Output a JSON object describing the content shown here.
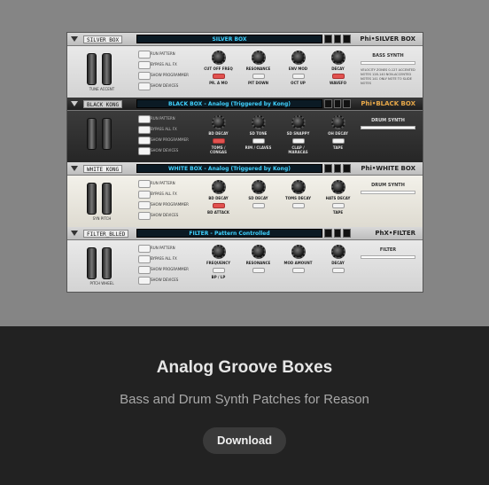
{
  "product": {
    "title": "Analog Groove Boxes",
    "subtitle": "Bass and Drum Synth Patches for Reason",
    "download_label": "Download"
  },
  "rack": {
    "units": [
      {
        "patch": "SILVER BOX",
        "display": "SILVER BOX",
        "brand": "Phi•SILVER BOX",
        "style": "light",
        "wheel_labels": "TUNE     ACCENT",
        "buttons": [
          "RUN PATTERN",
          "BYPASS ALL FX",
          "SHOW PROGRAMMER",
          "SHOW DEVICES"
        ],
        "knobs": [
          {
            "label": "CUT OFF FREQ",
            "led": "PR. A MO",
            "on": true
          },
          {
            "label": "RESONANCE",
            "led": "PIT DOWN",
            "on": false
          },
          {
            "label": "ENV MOD",
            "led": "OCT UP",
            "on": false
          },
          {
            "label": "DECAY",
            "led": "WAVEFO",
            "on": true
          }
        ],
        "panel_label": "BASS SYNTH",
        "panel_note": "VELOCITY ZONES\n0-127 ACCENTED NOTES\n128-140 NON-ACCENTED NOTES\n141 ONLY NOTE TO SLIDE NOTES"
      },
      {
        "patch": "BLACK KONG",
        "display": "BLACK BOX - Analog (Triggered by Kong)",
        "brand": "Phi•BLACK BOX",
        "style": "dark",
        "wheel_labels": "",
        "buttons": [
          "RUN PATTERN",
          "BYPASS ALL FX",
          "SHOW PROGRAMMER",
          "SHOW DEVICES"
        ],
        "knobs": [
          {
            "label": "BD DECAY",
            "led": "TOMS / CONGAS",
            "on": true
          },
          {
            "label": "SD TONE",
            "led": "RIM / CLAVES",
            "on": false
          },
          {
            "label": "SD SNAPPY",
            "led": "CLAP / MARACAS",
            "on": false
          },
          {
            "label": "OH DECAY",
            "led": "TAPE",
            "on": false
          }
        ],
        "panel_label": "DRUM SYNTH",
        "panel_note": ""
      },
      {
        "patch": "WHITE KONG",
        "display": "WHITE BOX - Analog (Triggered by Kong)",
        "brand": "Phi•WHITE BOX",
        "style": "cream",
        "wheel_labels": "SYN PITCH",
        "buttons": [
          "RUN PATTERN",
          "BYPASS ALL FX",
          "SHOW PROGRAMMER",
          "SHOW DEVICES"
        ],
        "knobs": [
          {
            "label": "BD DECAY",
            "led": "BD ATTACK",
            "on": true
          },
          {
            "label": "SD DECAY",
            "led": "",
            "on": false
          },
          {
            "label": "TOMS DECAY",
            "led": "",
            "on": false
          },
          {
            "label": "HATS DECAY",
            "led": "TAPE",
            "on": false
          }
        ],
        "panel_label": "DRUM SYNTH",
        "panel_note": ""
      },
      {
        "patch": "FILTER_BLLED",
        "display": "FILTER - Pattern Controlled",
        "brand": "PhX•FILTER",
        "style": "light",
        "wheel_labels": "PITCH     WHEEL",
        "buttons": [
          "RUN PATTERN",
          "BYPASS ALL FX",
          "SHOW PROGRAMMER",
          "SHOW DEVICES"
        ],
        "knobs": [
          {
            "label": "FREQUENCY",
            "led": "BP / LP",
            "on": false
          },
          {
            "label": "RESONANCE",
            "led": "",
            "on": false
          },
          {
            "label": "MOD AMOUNT",
            "led": "",
            "on": false
          },
          {
            "label": "DECAY",
            "led": "",
            "on": false
          }
        ],
        "panel_label": "FILTER",
        "panel_note": ""
      }
    ]
  },
  "colors": {
    "page_bg": "#222222",
    "preview_bg": "#858585",
    "button_bg": "#3a3a3a",
    "title_text": "#e6e6e6",
    "subtitle_text": "#a8a8a8",
    "lcd_text": "#3fd2ff",
    "led_on": "#e2524f"
  }
}
